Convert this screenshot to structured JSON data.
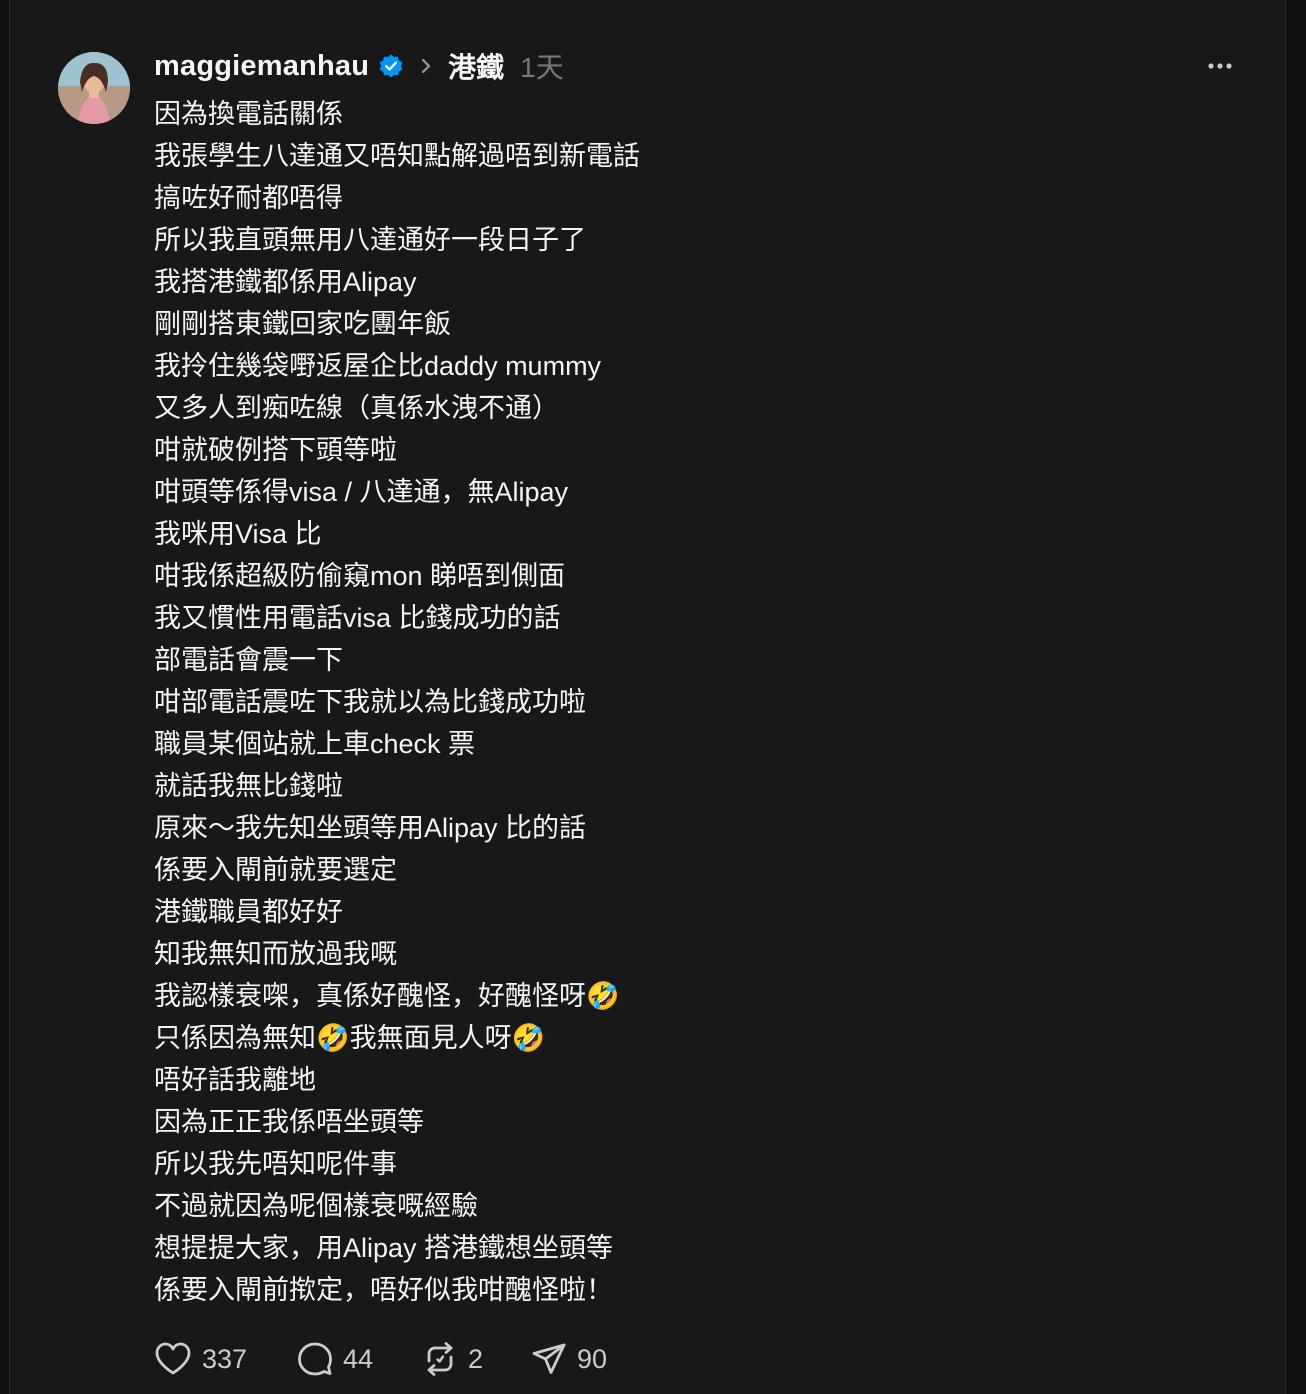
{
  "post": {
    "username": "maggiemanhau",
    "topic": "港鐵",
    "time": "1天",
    "lines": [
      "因為換電話關係",
      "我張學生八達通又唔知點解過唔到新電話",
      "搞咗好耐都唔得",
      "所以我直頭無用八達通好一段日子了",
      "我搭港鐵都係用Alipay",
      "剛剛搭東鐵回家吃團年飯",
      "我拎住幾袋嘢返屋企比daddy mummy",
      "又多人到痴咗線（真係水洩不通）",
      "咁就破例搭下頭等啦",
      "咁頭等係得visa / 八達通，無Alipay",
      "我咪用Visa 比",
      "咁我係超級防偷窺mon 睇唔到側面",
      "我又慣性用電話visa 比錢成功的話",
      "部電話會震一下",
      "咁部電話震咗下我就以為比錢成功啦",
      "職員某個站就上車check 票",
      "就話我無比錢啦",
      "原來～我先知坐頭等用Alipay 比的話",
      "係要入閘前就要選定",
      "港鐵職員都好好",
      "知我無知而放過我嘅",
      "我認樣衰㗎，真係好醜怪，好醜怪呀🤣",
      "只係因為無知🤣我無面見人呀🤣",
      "唔好話我離地",
      "因為正正我係唔坐頭等",
      "所以我先唔知呢件事",
      "不過就因為呢個樣衰嘅經驗",
      "想提提大家，用Alipay 搭港鐵想坐頭等",
      "係要入閘前揿定，唔好似我咁醜怪啦！"
    ]
  },
  "actions": {
    "likes": "337",
    "replies": "44",
    "reposts": "2",
    "shares": "90"
  },
  "colors": {
    "background": "#181818",
    "text": "#f3f5f7",
    "muted": "#777777",
    "verified": "#0095f6"
  },
  "icons": {
    "verified": "verified-badge-icon",
    "chevron": "chevron-right-icon",
    "more": "more-horizontal-icon",
    "like": "heart-icon",
    "reply": "comment-bubble-icon",
    "repost": "repost-icon",
    "share": "send-icon"
  }
}
